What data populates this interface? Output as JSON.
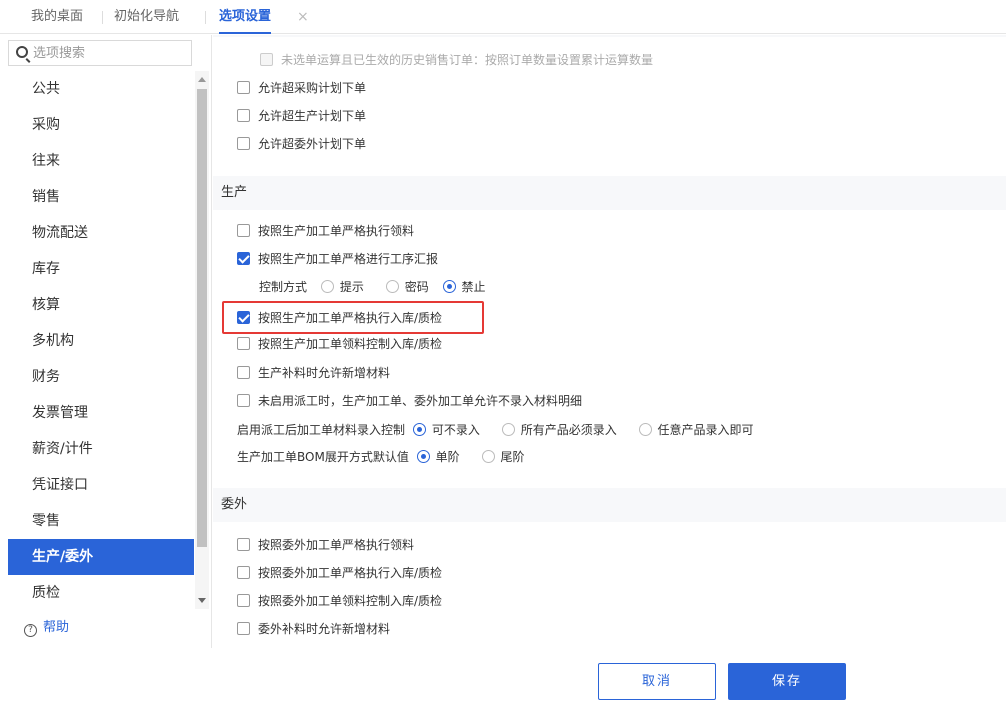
{
  "tabs": {
    "desktop": "我的桌面",
    "init_nav": "初始化导航",
    "options": "选项设置",
    "close": "×"
  },
  "sidebar": {
    "search_placeholder": "选项搜索",
    "items": [
      "公共",
      "采购",
      "往来",
      "销售",
      "物流配送",
      "库存",
      "核算",
      "多机构",
      "财务",
      "发票管理",
      "薪资/计件",
      "凭证接口",
      "零售",
      "生产/委外",
      "质检"
    ],
    "active": "生产/委外",
    "help": "帮助"
  },
  "content": {
    "prev": {
      "disabled_option": "未选单运算且已生效的历史销售订单：按照订单数量设置累计运算数量",
      "opt1": "允许超采购计划下单",
      "opt2": "允许超生产计划下单",
      "opt3": "允许超委外计划下单"
    },
    "production": {
      "title": "生产",
      "opt1": "按照生产加工单严格执行领料",
      "opt2": "按照生产加工单严格进行工序汇报",
      "control_label": "控制方式",
      "control_opts": [
        "提示",
        "密码",
        "禁止"
      ],
      "opt3": "按照生产加工单严格执行入库/质检",
      "opt4": "按照生产加工单领料控制入库/质检",
      "opt5": "生产补料时允许新增材料",
      "opt6": "未启用派工时，生产加工单、委外加工单允许不录入材料明细",
      "dispatch_label": "启用派工后加工单材料录入控制",
      "dispatch_opts": [
        "可不录入",
        "所有产品必须录入",
        "任意产品录入即可"
      ],
      "bom_label": "生产加工单BOM展开方式默认值",
      "bom_opts": [
        "单阶",
        "尾阶"
      ]
    },
    "outsource": {
      "title": "委外",
      "opt1": "按照委外加工单严格执行领料",
      "opt2": "按照委外加工单严格执行入库/质检",
      "opt3": "按照委外加工单领料控制入库/质检",
      "opt4": "委外补料时允许新增材料"
    }
  },
  "footer": {
    "cancel": "取消",
    "save": "保存"
  },
  "colors": {
    "accent": "#2a64d8",
    "highlight": "#e53935"
  }
}
